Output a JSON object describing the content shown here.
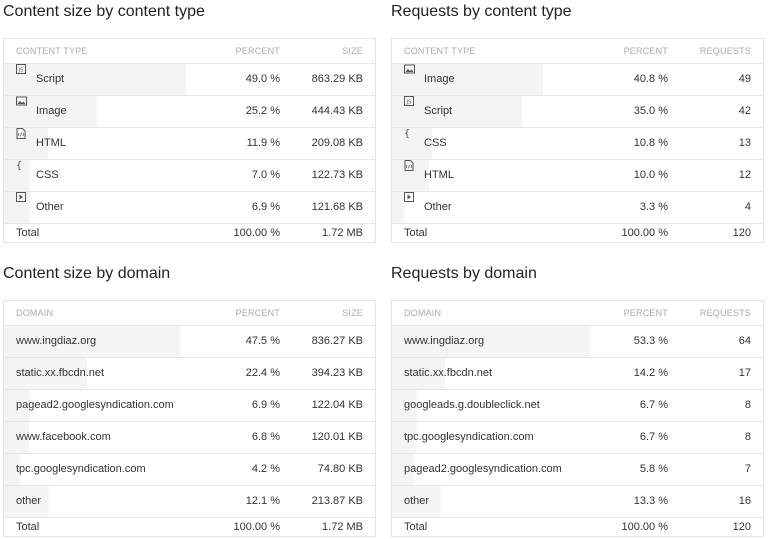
{
  "panels": [
    {
      "title": "Content size by content type",
      "headers": {
        "name": "CONTENT TYPE",
        "percent": "PERCENT",
        "value": "SIZE"
      },
      "rows": [
        {
          "icon": "js-file-icon",
          "name": "Script",
          "percent": "49.0 %",
          "value": "863.29 KB",
          "fraction": 0.49
        },
        {
          "icon": "image-icon",
          "name": "Image",
          "percent": "25.2 %",
          "value": "444.43 KB",
          "fraction": 0.252
        },
        {
          "icon": "html-file-icon",
          "name": "HTML",
          "percent": "11.9 %",
          "value": "209.08 KB",
          "fraction": 0.119
        },
        {
          "icon": "curly-braces-icon",
          "name": "CSS",
          "percent": "7.0 %",
          "value": "122.73 KB",
          "fraction": 0.07
        },
        {
          "icon": "play-icon",
          "name": "Other",
          "percent": "6.9 %",
          "value": "121.68 KB",
          "fraction": 0.069
        }
      ],
      "total": {
        "name": "Total",
        "percent": "100.00 %",
        "value": "1.72 MB"
      }
    },
    {
      "title": "Requests by content type",
      "headers": {
        "name": "CONTENT TYPE",
        "percent": "PERCENT",
        "value": "REQUESTS"
      },
      "rows": [
        {
          "icon": "image-icon",
          "name": "Image",
          "percent": "40.8 %",
          "value": "49",
          "fraction": 0.408
        },
        {
          "icon": "js-file-icon",
          "name": "Script",
          "percent": "35.0 %",
          "value": "42",
          "fraction": 0.35
        },
        {
          "icon": "curly-braces-icon",
          "name": "CSS",
          "percent": "10.8 %",
          "value": "13",
          "fraction": 0.108
        },
        {
          "icon": "html-file-icon",
          "name": "HTML",
          "percent": "10.0 %",
          "value": "12",
          "fraction": 0.1
        },
        {
          "icon": "play-icon",
          "name": "Other",
          "percent": "3.3 %",
          "value": "4",
          "fraction": 0.033
        }
      ],
      "total": {
        "name": "Total",
        "percent": "100.00 %",
        "value": "120"
      }
    },
    {
      "title": "Content size by domain",
      "headers": {
        "name": "DOMAIN",
        "percent": "PERCENT",
        "value": "SIZE"
      },
      "rows": [
        {
          "name": "www.ingdiaz.org",
          "percent": "47.5 %",
          "value": "836.27 KB",
          "fraction": 0.475
        },
        {
          "name": "static.xx.fbcdn.net",
          "percent": "22.4 %",
          "value": "394.23 KB",
          "fraction": 0.224
        },
        {
          "name": "pagead2.googlesyndication.com",
          "percent": "6.9 %",
          "value": "122.04 KB",
          "fraction": 0.069
        },
        {
          "name": "www.facebook.com",
          "percent": "6.8 %",
          "value": "120.01 KB",
          "fraction": 0.068
        },
        {
          "name": "tpc.googlesyndication.com",
          "percent": "4.2 %",
          "value": "74.80 KB",
          "fraction": 0.042
        },
        {
          "name": "other",
          "percent": "12.1 %",
          "value": "213.87 KB",
          "fraction": 0.121
        }
      ],
      "total": {
        "name": "Total",
        "percent": "100.00 %",
        "value": "1.72 MB"
      }
    },
    {
      "title": "Requests by domain",
      "headers": {
        "name": "DOMAIN",
        "percent": "PERCENT",
        "value": "REQUESTS"
      },
      "rows": [
        {
          "name": "www.ingdiaz.org",
          "percent": "53.3 %",
          "value": "64",
          "fraction": 0.533
        },
        {
          "name": "static.xx.fbcdn.net",
          "percent": "14.2 %",
          "value": "17",
          "fraction": 0.142
        },
        {
          "name": "googleads.g.doubleclick.net",
          "percent": "6.7 %",
          "value": "8",
          "fraction": 0.067
        },
        {
          "name": "tpc.googlesyndication.com",
          "percent": "6.7 %",
          "value": "8",
          "fraction": 0.067
        },
        {
          "name": "pagead2.googlesyndication.com",
          "percent": "5.8 %",
          "value": "7",
          "fraction": 0.058
        },
        {
          "name": "other",
          "percent": "13.3 %",
          "value": "16",
          "fraction": 0.133
        }
      ],
      "total": {
        "name": "Total",
        "percent": "100.00 %",
        "value": "120"
      }
    }
  ]
}
